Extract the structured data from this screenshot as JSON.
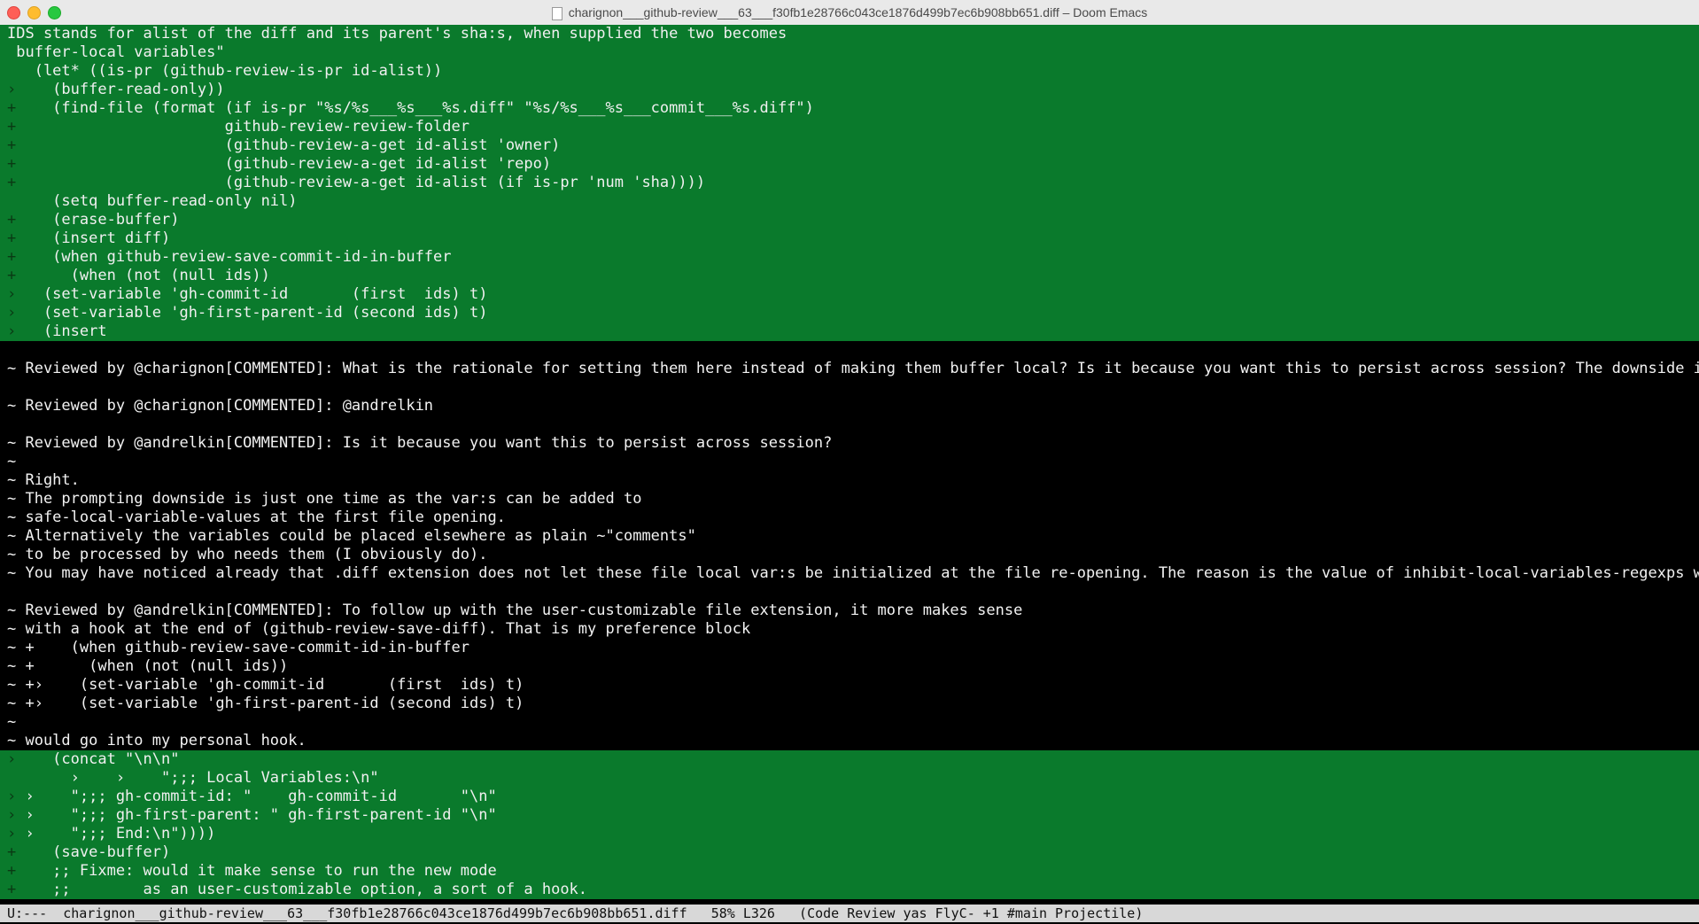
{
  "window": {
    "title": "charignon___github-review___63___f30fb1e28766c043ce1876d499b7ec6b908bb651.diff – Doom Emacs"
  },
  "lines": [
    {
      "type": "add",
      "fringe": "",
      "text": "IDS stands for alist of the diff and its parent's sha:s, when supplied the two becomes"
    },
    {
      "type": "add",
      "fringe": "",
      "text": " buffer-local variables\""
    },
    {
      "type": "add",
      "fringe": "",
      "text": "   (let* ((is-pr (github-review-is-pr id-alist))"
    },
    {
      "type": "add",
      "fringe": "›",
      "text": "     (buffer-read-only))"
    },
    {
      "type": "add",
      "fringe": "+",
      "text": "     (find-file (format (if is-pr \"%s/%s___%s___%s.diff\" \"%s/%s___%s___commit___%s.diff\")"
    },
    {
      "type": "add",
      "fringe": "+",
      "text": "                        github-review-review-folder"
    },
    {
      "type": "add",
      "fringe": "+",
      "text": "                        (github-review-a-get id-alist 'owner)"
    },
    {
      "type": "add",
      "fringe": "+",
      "text": "                        (github-review-a-get id-alist 'repo)"
    },
    {
      "type": "add",
      "fringe": "+",
      "text": "                        (github-review-a-get id-alist (if is-pr 'num 'sha)))) "
    },
    {
      "type": "add",
      "fringe": "",
      "text": "     (setq buffer-read-only nil)"
    },
    {
      "type": "add",
      "fringe": "+",
      "text": "     (erase-buffer)"
    },
    {
      "type": "add",
      "fringe": "+",
      "text": "     (insert diff)"
    },
    {
      "type": "add",
      "fringe": "+",
      "text": "     (when github-review-save-commit-id-in-buffer"
    },
    {
      "type": "add",
      "fringe": "+",
      "text": "       (when (not (null ids))"
    },
    {
      "type": "add",
      "fringe": "›",
      "text": "    (set-variable 'gh-commit-id       (first  ids) t)"
    },
    {
      "type": "add",
      "fringe": "›",
      "text": "    (set-variable 'gh-first-parent-id (second ids) t)"
    },
    {
      "type": "add",
      "fringe": "›",
      "text": "    (insert"
    },
    {
      "type": "ctx",
      "fringe": "",
      "text": ""
    },
    {
      "type": "ctx",
      "fringe": "",
      "text": "~ Reviewed by @charignon[COMMENTED]: What is the rationale for setting them here instead of making them buffer local? Is it because you want this to persist across session? The downside is th"
    },
    {
      "type": "ctx",
      "fringe": "",
      "text": ""
    },
    {
      "type": "ctx",
      "fringe": "",
      "text": "~ Reviewed by @charignon[COMMENTED]: @andrelkin"
    },
    {
      "type": "ctx",
      "fringe": "",
      "text": ""
    },
    {
      "type": "ctx",
      "fringe": "",
      "text": "~ Reviewed by @andrelkin[COMMENTED]: Is it because you want this to persist across session?"
    },
    {
      "type": "ctx",
      "fringe": "",
      "text": "~"
    },
    {
      "type": "ctx",
      "fringe": "",
      "text": "~ Right."
    },
    {
      "type": "ctx",
      "fringe": "",
      "text": "~ The prompting downside is just one time as the var:s can be added to"
    },
    {
      "type": "ctx",
      "fringe": "",
      "text": "~ safe-local-variable-values at the first file opening."
    },
    {
      "type": "ctx",
      "fringe": "",
      "text": "~ Alternatively the variables could be placed elsewhere as plain ~\"comments\""
    },
    {
      "type": "ctx",
      "fringe": "",
      "text": "~ to be processed by who needs them (I obviously do)."
    },
    {
      "type": "ctx",
      "fringe": "",
      "text": "~ You may have noticed already that .diff extension does not let these file local var:s be initialized at the file re-opening. The reason is the value of inhibit-local-variables-regexps which"
    },
    {
      "type": "ctx",
      "fringe": "",
      "text": ""
    },
    {
      "type": "ctx",
      "fringe": "",
      "text": "~ Reviewed by @andrelkin[COMMENTED]: To follow up with the user-customizable file extension, it more makes sense"
    },
    {
      "type": "ctx",
      "fringe": "",
      "text": "~ with a hook at the end of (github-review-save-diff). That is my preference block"
    },
    {
      "type": "ctx",
      "fringe": "",
      "text": "~ +    (when github-review-save-commit-id-in-buffer"
    },
    {
      "type": "ctx",
      "fringe": "",
      "text": "~ +      (when (not (null ids))"
    },
    {
      "type": "ctx",
      "fringe": "",
      "text": "~ +›    (set-variable 'gh-commit-id       (first  ids) t)"
    },
    {
      "type": "ctx",
      "fringe": "",
      "text": "~ +›    (set-variable 'gh-first-parent-id (second ids) t)"
    },
    {
      "type": "ctx",
      "fringe": "",
      "text": "~"
    },
    {
      "type": "ctx",
      "fringe": "",
      "text": "~ would go into my personal hook."
    },
    {
      "type": "add",
      "fringe": "›",
      "text": "     (concat \"\\n\\n\""
    },
    {
      "type": "add",
      "fringe": "",
      "text": "       ›    ›    \";;; Local Variables:\\n\""
    },
    {
      "type": "add",
      "fringe": "›",
      "text": "  ›    \";;; gh-commit-id: \"    gh-commit-id       \"\\n\""
    },
    {
      "type": "add",
      "fringe": "›",
      "text": "  ›    \";;; gh-first-parent: \" gh-first-parent-id \"\\n\""
    },
    {
      "type": "add",
      "fringe": "›",
      "text": "  ›    \";;; End:\\n\"))))"
    },
    {
      "type": "add",
      "fringe": "+",
      "text": "     (save-buffer)"
    },
    {
      "type": "add",
      "fringe": "+",
      "text": "     ;; Fixme: would it make sense to run the new mode"
    },
    {
      "type": "add",
      "fringe": "+",
      "text": "     ;;        as an user-customizable option, a sort of a hook."
    }
  ],
  "modeline": {
    "text": "U:---  charignon___github-review___63___f30fb1e28766c043ce1876d499b7ec6b908bb651.diff   58% L326   (Code Review yas FlyC- +1 #main Projectile)"
  }
}
